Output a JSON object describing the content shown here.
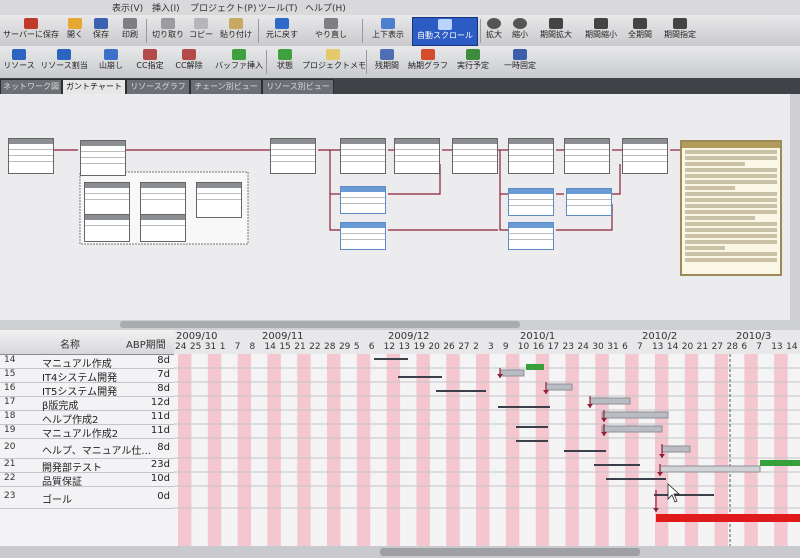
{
  "menu": {
    "items": [
      "表示(V)",
      "挿入(I)",
      "プロジェクト(P)",
      "ツール(T)",
      "ヘルプ(H)"
    ]
  },
  "toolbar1": {
    "buttons": [
      {
        "label": "サーバーに保存",
        "icon": "server-save-icon"
      },
      {
        "label": "開く",
        "icon": "folder-open-icon"
      },
      {
        "label": "保存",
        "icon": "save-icon"
      },
      {
        "label": "印刷",
        "icon": "print-icon"
      },
      {
        "label": "切り取り",
        "icon": "cut-icon"
      },
      {
        "label": "コピー",
        "icon": "copy-icon"
      },
      {
        "label": "貼り付け",
        "icon": "paste-icon"
      },
      {
        "label": "元に戻す",
        "icon": "undo-icon"
      },
      {
        "label": "やり直し",
        "icon": "redo-icon"
      },
      {
        "label": "上下表示",
        "icon": "split-view-icon"
      },
      {
        "label": "自動スクロール",
        "icon": "auto-scroll-icon"
      },
      {
        "label": "拡大",
        "icon": "zoom-in-icon"
      },
      {
        "label": "縮小",
        "icon": "zoom-out-icon"
      },
      {
        "label": "期間拡大",
        "icon": "expand-period-icon"
      },
      {
        "label": "期間縮小",
        "icon": "shrink-period-icon"
      },
      {
        "label": "全期間",
        "icon": "full-period-icon"
      },
      {
        "label": "期間指定",
        "icon": "specify-period-icon"
      }
    ]
  },
  "toolbar2": {
    "buttons": [
      {
        "label": "リソース",
        "icon": "resource-icon"
      },
      {
        "label": "リソース割当",
        "icon": "resource-assign-icon"
      },
      {
        "label": "山崩し",
        "icon": "leveling-icon"
      },
      {
        "label": "CC指定",
        "icon": "cc-specify-icon"
      },
      {
        "label": "CC解除",
        "icon": "cc-release-icon"
      },
      {
        "label": "バッファ挿入",
        "icon": "buffer-insert-icon"
      },
      {
        "label": "状態",
        "icon": "status-icon"
      },
      {
        "label": "プロジェクトメモ",
        "icon": "project-memo-icon"
      },
      {
        "label": "残期間",
        "icon": "remaining-period-icon"
      },
      {
        "label": "納期グラフ",
        "icon": "deadline-graph-icon"
      },
      {
        "label": "実行予定",
        "icon": "execution-plan-icon"
      },
      {
        "label": "一時固定",
        "icon": "temp-fix-icon"
      }
    ]
  },
  "tabs": [
    "ネットワーク図",
    "ガントチャート",
    "リソースグラフ",
    "チェーン別ビュー",
    "リソース別ビュー"
  ],
  "gantt": {
    "headers": {
      "name": "名称",
      "duration": "ABP期間"
    },
    "months": [
      {
        "label": "2009/10"
      },
      {
        "label": "2009/11"
      },
      {
        "label": "2009/12"
      },
      {
        "label": "2010/1"
      },
      {
        "label": "2010/2"
      },
      {
        "label": "2010/3"
      }
    ],
    "days": [
      "24",
      "25",
      "31",
      "1",
      "7",
      "8",
      "14",
      "15",
      "21",
      "22",
      "28",
      "29",
      "5",
      "6",
      "12",
      "13",
      "19",
      "20",
      "26",
      "27",
      "2",
      "3",
      "9",
      "10",
      "16",
      "17",
      "23",
      "24",
      "30",
      "31",
      "6",
      "7",
      "13",
      "14",
      "20",
      "21",
      "27",
      "28",
      "6",
      "7",
      "13",
      "14"
    ],
    "rows": [
      {
        "num": "14",
        "name": "マニュアル作成",
        "duration": "8d"
      },
      {
        "num": "15",
        "name": "IT4システム開発",
        "duration": "7d"
      },
      {
        "num": "16",
        "name": "IT5システム開発",
        "duration": "8d"
      },
      {
        "num": "17",
        "name": "β版完成",
        "duration": "12d"
      },
      {
        "num": "18",
        "name": "ヘルプ作成2",
        "duration": "11d"
      },
      {
        "num": "19",
        "name": "マニュアル作成2",
        "duration": "11d"
      },
      {
        "num": "20",
        "name": "ヘルプ、マニュアル仕...",
        "duration": "8d"
      },
      {
        "num": "21",
        "name": "開発部テスト",
        "duration": "23d"
      },
      {
        "num": "22",
        "name": "品質保証",
        "duration": "10d"
      },
      {
        "num": "23",
        "name": "ゴール",
        "duration": "0d"
      }
    ]
  },
  "colors": {
    "accent": "#2d5bc4",
    "critical": "#e01b1b",
    "arrow": "#8c1f3a",
    "buffer": "#38a03a"
  }
}
